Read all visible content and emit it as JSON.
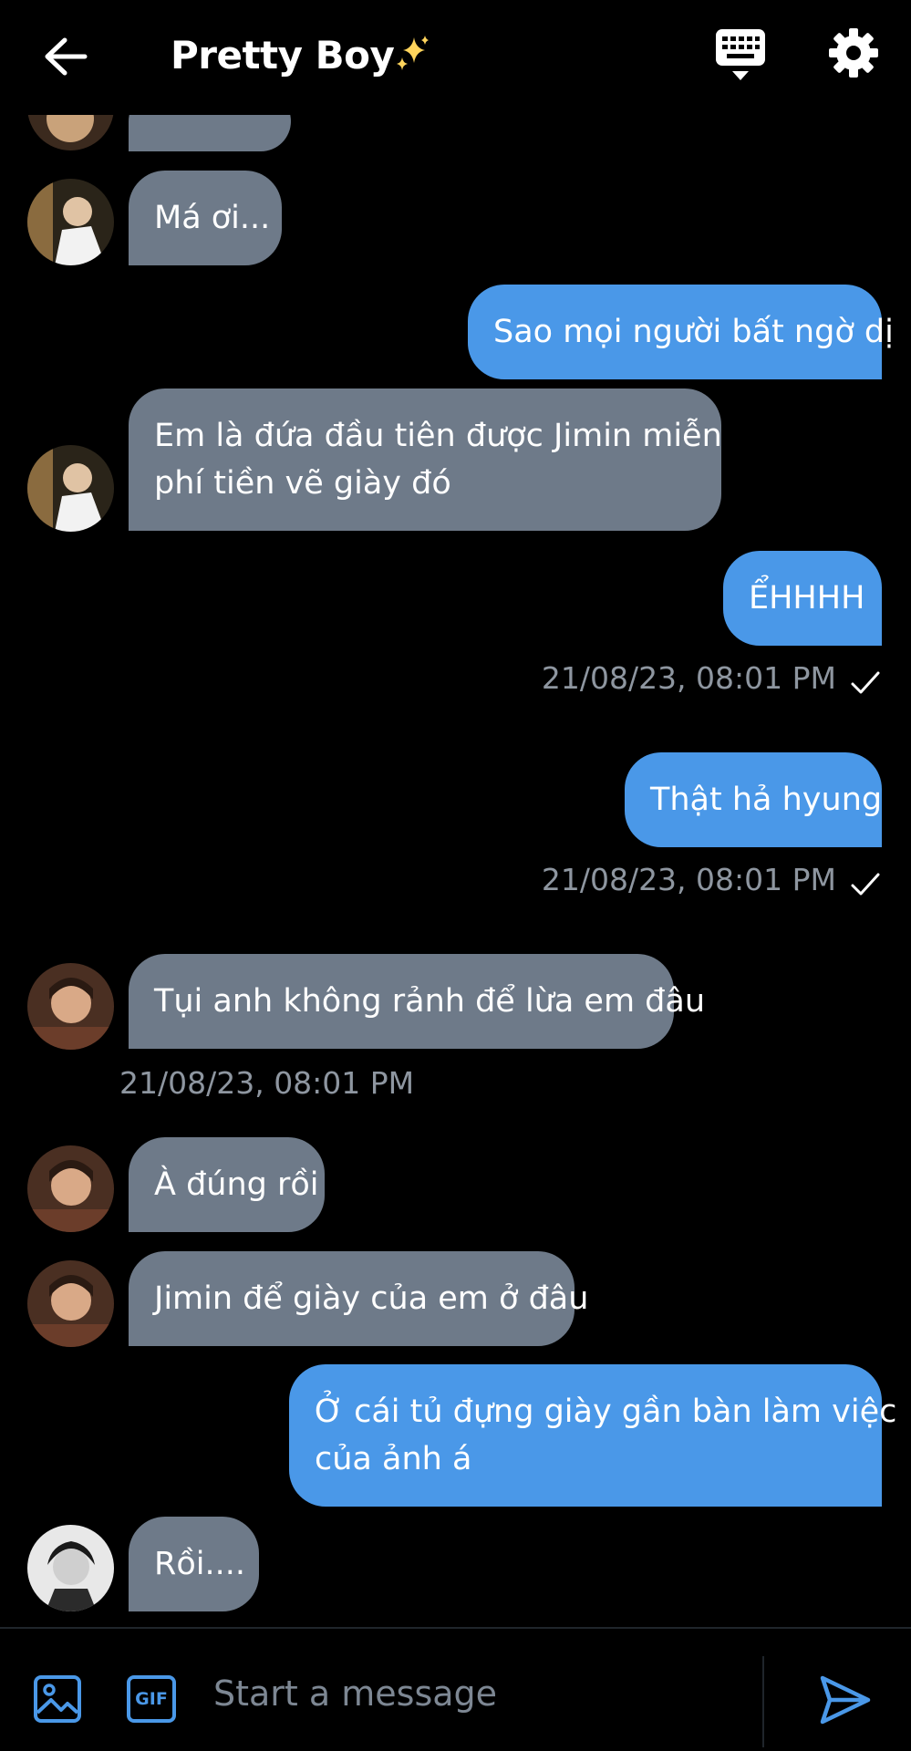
{
  "header": {
    "back_icon": "arrow-left-icon",
    "title": "Pretty Boy",
    "title_emoji": "sparkles-icon",
    "keyboard_icon": "keyboard-icon",
    "settings_icon": "gear-icon"
  },
  "messages": [
    {
      "side": "in",
      "text": ""
    },
    {
      "side": "in",
      "text": "Má ơi..."
    },
    {
      "side": "out",
      "text": "Sao mọi người bất ngờ dị"
    },
    {
      "side": "in",
      "text": "Em là đứa đầu tiên được Jimin miễn phí tiền vẽ giày đó",
      "line1": "Em là đứa đầu tiên được Jimin miễn",
      "line2": "phí tiền vẽ giày đó"
    },
    {
      "side": "out",
      "text": "ỂHHHH",
      "timestamp": "21/08/23, 08:01 PM"
    },
    {
      "side": "out",
      "text": "Thật hả hyung",
      "timestamp": "21/08/23, 08:01 PM"
    },
    {
      "side": "in",
      "text": "Tụi anh không rảnh để lừa em đâu",
      "timestamp": "21/08/23, 08:01 PM"
    },
    {
      "side": "in",
      "text": "À đúng rồi"
    },
    {
      "side": "in",
      "text": "Jimin để giày của em ở đâu"
    },
    {
      "side": "out",
      "text": "Ở cái tủ đựng giày gần bàn làm việc của ảnh á",
      "line1": "Ở cái tủ đựng giày gần bàn làm việc",
      "line2": "của ảnh á"
    },
    {
      "side": "in",
      "text": "Rồi...."
    }
  ],
  "composer": {
    "image_icon": "image-icon",
    "gif_label": "GIF",
    "placeholder": "Start a message",
    "send_icon": "send-icon"
  },
  "colors": {
    "background": "#000000",
    "incoming_bubble": "#6e7a89",
    "outgoing_bubble": "#4a98e8",
    "timestamp": "#8e96a0",
    "accent": "#4a98e8"
  }
}
